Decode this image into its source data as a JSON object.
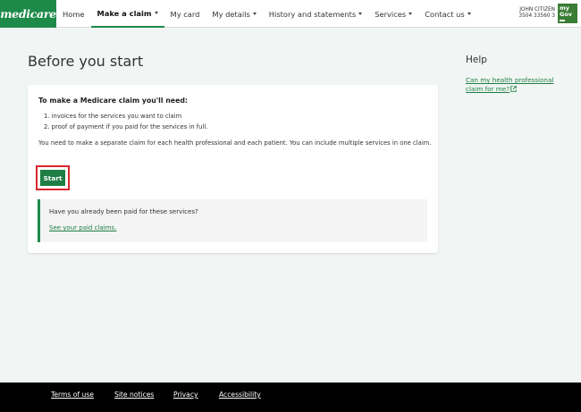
{
  "brand": {
    "logo_text": "medicare",
    "accent": "#1e8a4a"
  },
  "nav": {
    "items": [
      {
        "label": "Home",
        "dropdown": false
      },
      {
        "label": "Make a claim",
        "dropdown": true,
        "active": true
      },
      {
        "label": "My card",
        "dropdown": false
      },
      {
        "label": "My details",
        "dropdown": true
      },
      {
        "label": "History and statements",
        "dropdown": true
      },
      {
        "label": "Services",
        "dropdown": true
      },
      {
        "label": "Contact us",
        "dropdown": true
      }
    ]
  },
  "user": {
    "name": "JOHN CITIZEN",
    "number": "3504 33560 3",
    "mygov_line1": "my",
    "mygov_line2": "Gov"
  },
  "page": {
    "title": "Before you start"
  },
  "card": {
    "heading": "To make a Medicare claim you'll need:",
    "requirements": [
      "1. invoices for the services you want to claim",
      "2. proof of payment if you paid for the services in full."
    ],
    "note": "You need to make a separate claim for each health professional and each patient. You can include multiple services in one claim.",
    "start_label": "Start",
    "callout_question": "Have you already been paid for these services?",
    "callout_link": "See your paid claims."
  },
  "help": {
    "title": "Help",
    "link": "Can my health professional claim for me?",
    "link_icon": "external-link-icon"
  },
  "footer": {
    "links": [
      "Terms of use",
      "Site notices",
      "Privacy",
      "Accessibility"
    ]
  }
}
